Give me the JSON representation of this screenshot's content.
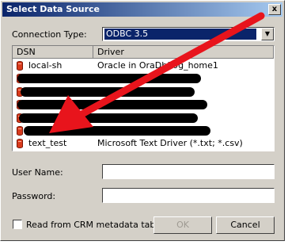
{
  "window": {
    "title": "Select Data Source",
    "close_glyph": "x"
  },
  "connection_type": {
    "label": "Connection Type:",
    "value": "ODBC 3.5",
    "arrow_glyph": "▼"
  },
  "list": {
    "columns": [
      "DSN",
      "Driver"
    ],
    "rows": [
      {
        "dsn": "local-sh",
        "driver": "Oracle in OraDb10g_home1",
        "redacted": false
      },
      {
        "dsn": "",
        "driver": "",
        "redacted": true
      },
      {
        "dsn": "",
        "driver": "",
        "redacted": true
      },
      {
        "dsn": "",
        "driver": "",
        "redacted": true
      },
      {
        "dsn": "",
        "driver": "",
        "redacted": true
      },
      {
        "dsn": "",
        "driver": "",
        "redacted": true
      },
      {
        "dsn": "text_test",
        "driver": "Microsoft Text Driver (*.txt; *.csv)",
        "redacted": false
      }
    ]
  },
  "user_name": {
    "label": "User Name:",
    "value": ""
  },
  "password": {
    "label": "Password:",
    "value": ""
  },
  "crm_checkbox": {
    "label": "Read from CRM metadata tables",
    "checked": false
  },
  "buttons": {
    "ok": "OK",
    "cancel": "Cancel",
    "ok_enabled": false
  },
  "annotation": {
    "type": "arrow",
    "color": "#e8141c"
  }
}
